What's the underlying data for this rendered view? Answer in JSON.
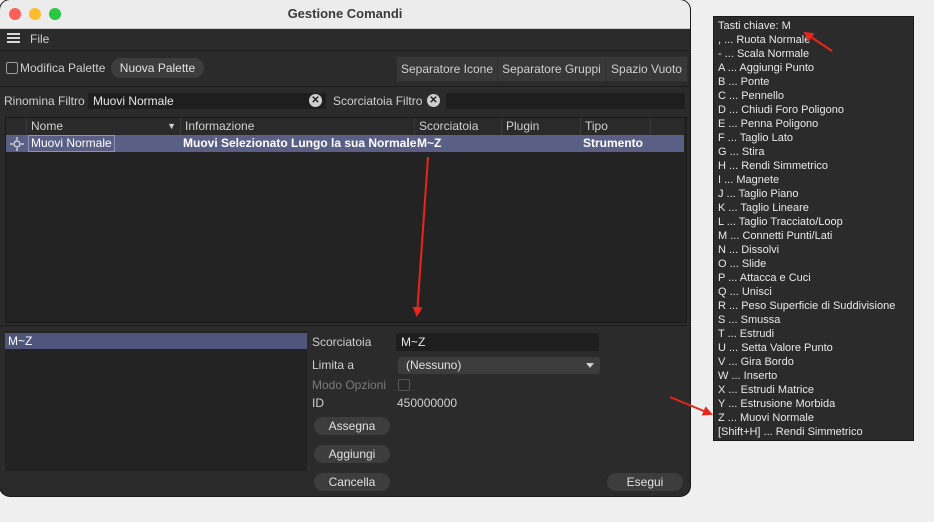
{
  "window": {
    "title": "Gestione Comandi",
    "menu": {
      "file": "File"
    }
  },
  "toolbar": {
    "modifica_palette": "Modifica Palette",
    "nuova_palette": "Nuova Palette",
    "separatore_icone": "Separatore Icone",
    "separatore_gruppi": "Separatore Gruppi",
    "spazio_vuoto": "Spazio Vuoto"
  },
  "filters": {
    "rinomina_label": "Rinomina Filtro",
    "rinomina_value": "Muovi Normale",
    "scorciatoia_label": "Scorciatoia Filtro",
    "scorciatoia_value": ""
  },
  "table": {
    "headers": [
      "Nome",
      "Informazione",
      "Scorciatoia",
      "Plugin",
      "Tipo"
    ],
    "rows": [
      {
        "nome": "Muovi Normale",
        "informazione": "Muovi Selezionato Lungo la sua Normale",
        "scorciatoia": "M~Z",
        "plugin": "",
        "tipo": "Strumento"
      }
    ]
  },
  "shortcut_list": [
    "M~Z"
  ],
  "details": {
    "scorciatoia_label": "Scorciatoia",
    "scorciatoia_value": "M~Z",
    "limita_label": "Limita a",
    "limita_value": "(Nessuno)",
    "modo_opzioni_label": "Modo Opzioni",
    "id_label": "ID",
    "id_value": "450000000"
  },
  "actions": {
    "assegna": "Assegna",
    "aggiungi": "Aggiungi",
    "cancella": "Cancella",
    "esegui": "Esegui"
  },
  "hotkey_popup": {
    "lines": [
      "Tasti chiave: M",
      ", ... Ruota Normale",
      "- ... Scala Normale",
      "A ... Aggiungi Punto",
      "B ... Ponte",
      "C ... Pennello",
      "D ... Chiudi Foro Poligono",
      "E ... Penna Poligono",
      "F ... Taglio Lato",
      "G ... Stira",
      "H ... Rendi Simmetrico",
      "I ... Magnete",
      "J ... Taglio Piano",
      "K ... Taglio Lineare",
      "L ... Taglio Tracciato/Loop",
      "M ... Connetti Punti/Lati",
      "N ... Dissolvi",
      "O ... Slide",
      "P ... Attacca e Cuci",
      "Q ... Unisci",
      "R ... Peso Superficie di Suddivisione",
      "S ... Smussa",
      "T ... Estrudi",
      "U ... Setta Valore Punto",
      "V ... Gira Bordo",
      "W ... Inserto",
      "X ... Estrudi Matrice",
      "Y ... Estrusione Morbida",
      "Z ... Muovi Normale",
      "[Shift+H] ... Rendi Simmetrico"
    ]
  },
  "colors": {
    "selection": "#5a5f86",
    "annotation_arrow": "#e8261c"
  }
}
